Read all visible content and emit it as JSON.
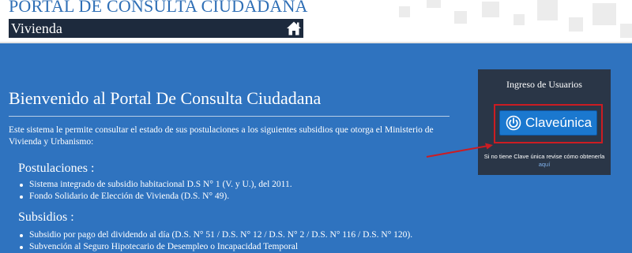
{
  "header": {
    "portal_title": "PORTAL DE CONSULTA CIUDADANA",
    "section_label": "Vivienda",
    "home_icon": "home-icon"
  },
  "main": {
    "welcome_title": "Bienvenido al Portal De Consulta Ciudadana",
    "intro": "Este sistema le permite consultar el estado de sus postulaciones a los siguientes subsidios que otorga el Ministerio de Vivienda y Urbanismo:",
    "postulaciones": {
      "title": "Postulaciones :",
      "items": [
        "Sistema integrado de subsidio habitacional D.S N° 1 (V. y U.), del 2011.",
        "Fondo Solidario de Elección de Vivienda (D.S. N° 49)."
      ]
    },
    "subsidios": {
      "title": "Subsidios :",
      "items": [
        "Subsidio por pago del dividendo al día (D.S. N° 51 / D.S. N° 12 / D.S. N° 2 / D.S. N° 116 / D.S. N° 120).",
        "Subvención al Seguro Hipotecario de Desempleo o Incapacidad Temporal"
      ]
    }
  },
  "login": {
    "title": "Ingreso de Usuarios",
    "button_label": "Claveúnica",
    "button_icon": "power-icon",
    "note_prefix": "Si no tiene Clave única revise cómo obtenerla",
    "note_link": "aquí"
  },
  "colors": {
    "background": "#2f73bf",
    "header_title": "#2f6fb6",
    "subbar": "#1d2a3d",
    "login_box": "#2a3647",
    "clave_button": "#1b78cf",
    "highlight": "#cc1c22"
  }
}
